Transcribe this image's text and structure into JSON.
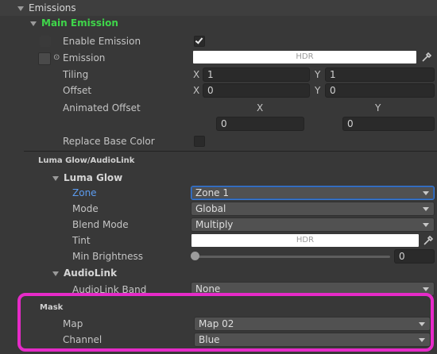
{
  "emissions": {
    "title": "Emissions",
    "main_emission": {
      "title": "Main Emission",
      "enable_label": "Enable Emission",
      "emission_label": "Emission",
      "emission_hdr": "HDR",
      "tiling_label": "Tiling",
      "tiling_x_axis": "X",
      "tiling_x": "1",
      "tiling_y_axis": "Y",
      "tiling_y": "1",
      "offset_label": "Offset",
      "offset_x_axis": "X",
      "offset_x": "0",
      "offset_y_axis": "Y",
      "offset_y": "0",
      "animated_offset_label": "Animated Offset",
      "animated_x_axis": "X",
      "animated_x": "0",
      "animated_y_axis": "Y",
      "animated_y": "0",
      "replace_base_label": "Replace Base Color"
    }
  },
  "luma_glow_audiolink": {
    "title": "Luma Glow/AudioLink",
    "luma_glow": {
      "title": "Luma Glow",
      "zone_label": "Zone",
      "zone_value": "Zone 1",
      "mode_label": "Mode",
      "mode_value": "Global",
      "blend_label": "Blend Mode",
      "blend_value": "Multiply",
      "tint_label": "Tint",
      "tint_hdr": "HDR",
      "min_brightness_label": "Min Brightness",
      "min_brightness_value": "0"
    },
    "audiolink": {
      "title": "AudioLink",
      "band_label": "AudioLink Band",
      "band_value": "None"
    }
  },
  "mask": {
    "title": "Mask",
    "map_label": "Map",
    "map_value": "Map 02",
    "channel_label": "Channel",
    "channel_value": "Blue"
  },
  "colors": {
    "section_green": "#3fd64a",
    "zone_highlight": "#5c9cf0",
    "mask_outline": "#e62bc8"
  }
}
